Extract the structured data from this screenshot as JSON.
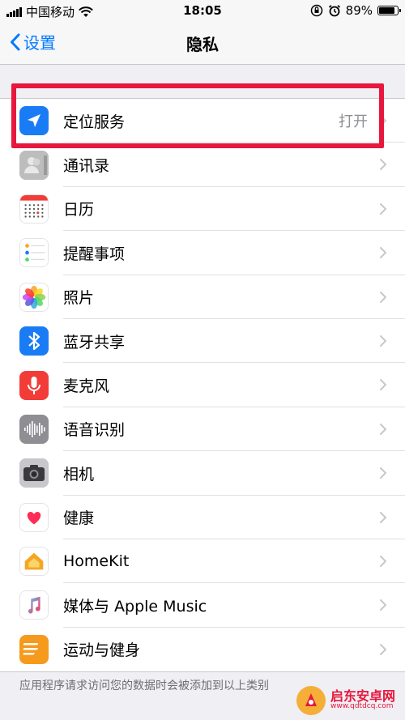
{
  "status_bar": {
    "carrier": "中国移动",
    "time": "18:05",
    "battery_percent": "89%",
    "battery_level": 89
  },
  "nav": {
    "back_label": "设置",
    "title": "隐私"
  },
  "rows": [
    {
      "label": "定位服务",
      "value": "打开",
      "icon": "location-arrow-icon",
      "color": "#1a7cf5"
    },
    {
      "label": "通讯录",
      "value": "",
      "icon": "contacts-icon",
      "color": "#b8b8b8"
    },
    {
      "label": "日历",
      "value": "",
      "icon": "calendar-icon",
      "color": "#ffffff"
    },
    {
      "label": "提醒事项",
      "value": "",
      "icon": "reminders-icon",
      "color": "#ffffff"
    },
    {
      "label": "照片",
      "value": "",
      "icon": "photos-icon",
      "color": "#ffffff"
    },
    {
      "label": "蓝牙共享",
      "value": "",
      "icon": "bluetooth-icon",
      "color": "#1a7cf5"
    },
    {
      "label": "麦克风",
      "value": "",
      "icon": "microphone-icon",
      "color": "#f23c38"
    },
    {
      "label": "语音识别",
      "value": "",
      "icon": "speech-recognition-icon",
      "color": "#8e8e93"
    },
    {
      "label": "相机",
      "value": "",
      "icon": "camera-icon",
      "color": "#8e8e93"
    },
    {
      "label": "健康",
      "value": "",
      "icon": "health-heart-icon",
      "color": "#ffffff"
    },
    {
      "label": "HomeKit",
      "value": "",
      "icon": "homekit-icon",
      "color": "#ffffff"
    },
    {
      "label": "媒体与 Apple Music",
      "value": "",
      "icon": "music-note-icon",
      "color": "#ffffff"
    },
    {
      "label": "运动与健身",
      "value": "",
      "icon": "motion-fitness-icon",
      "color": "#f59a1c"
    }
  ],
  "footer_note": "应用程序请求访问您的数据时会被添加到以上类别",
  "watermark": {
    "name": "启东安卓网",
    "url": "www.qdtdcq.com"
  },
  "colors": {
    "accent": "#007aff",
    "highlight": "#e8173d"
  }
}
